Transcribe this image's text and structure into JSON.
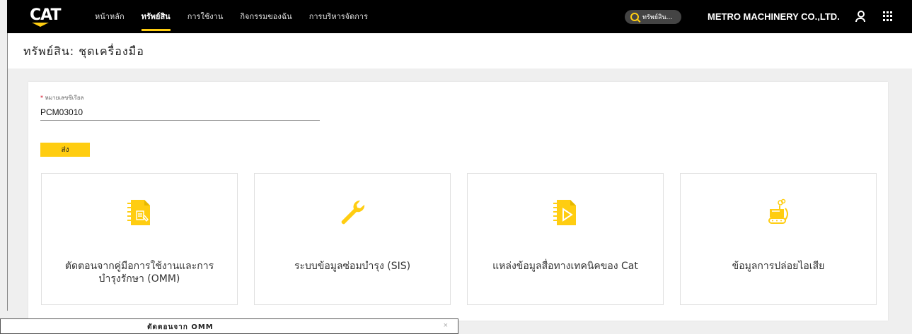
{
  "header": {
    "logo": "CAT",
    "nav": [
      "หน้าหลัก",
      "ทรัพย์สิน",
      "การใช้งาน",
      "กิจกรรมของฉัน",
      "การบริหารจัดการ"
    ],
    "active_index": 1,
    "search_text": "ทรัพย์สิน...",
    "company": "METRO MACHINERY CO.,LTD."
  },
  "page": {
    "title": "ทรัพย์สิน: ชุดเครื่องมือ"
  },
  "form": {
    "required_mark": "*",
    "serial_label": "หมายเลขซีเรียล",
    "serial_value": "PCM03010",
    "submit_label": "ส่ง"
  },
  "tiles": [
    {
      "label": "ตัดตอนจากคู่มือการใช้งานและการบำรุงรักษา (OMM)",
      "icon": "omm-document-icon"
    },
    {
      "label": "ระบบข้อมูลซ่อมบำรุง (SIS)",
      "icon": "wrench-icon"
    },
    {
      "label": "แหล่งข้อมูลสื่อทางเทคนิคของ Cat",
      "icon": "media-document-icon"
    },
    {
      "label": "ข้อมูลการปล่อยไอเสีย",
      "icon": "emissions-machine-icon"
    }
  ],
  "modal": {
    "title": "ตัดตอนจาก OMM",
    "close": "×"
  },
  "colors": {
    "accent": "#ffcd11",
    "topbar": "#000000"
  }
}
